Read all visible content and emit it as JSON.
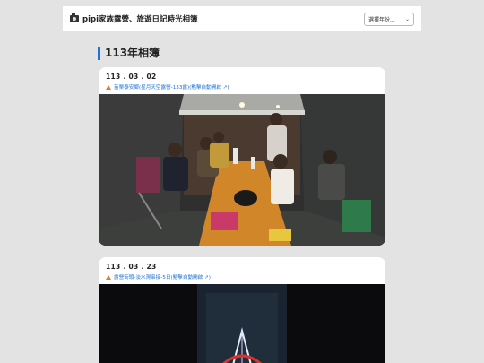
{
  "header": {
    "title": "pipi家族露營、旅遊日記時光相簿",
    "year_select": "選擇年份..."
  },
  "section": {
    "title": "113年相簿"
  },
  "posts": [
    {
      "date": "113 . 03 . 02",
      "location": "苗栗泰安鄉(星月天空露營-133露)(點擊自動開啟 ↗)"
    },
    {
      "date": "113 . 03 . 23",
      "location": "露營街頭-淡水灣串接-5日(點擊自動開啟 ↗)"
    }
  ]
}
